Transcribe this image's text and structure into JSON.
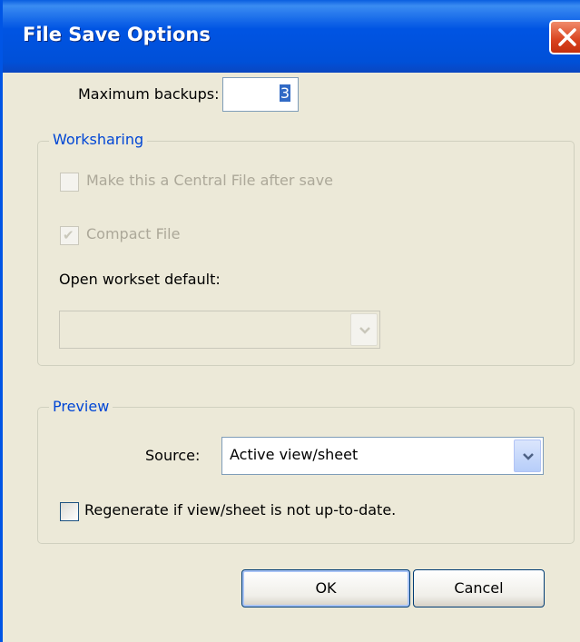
{
  "window": {
    "title": "File Save Options",
    "close_icon": "close-icon"
  },
  "backups": {
    "label": "Maximum backups:",
    "value": "3"
  },
  "worksharing": {
    "title": "Worksharing",
    "central_file_label": "Make this a Central File after save",
    "central_file_checked": false,
    "compact_file_label": "Compact File",
    "compact_file_checked": true,
    "workset_label": "Open workset default:",
    "workset_value": ""
  },
  "preview": {
    "title": "Preview",
    "source_label": "Source:",
    "source_value": "Active view/sheet",
    "regenerate_label": "Regenerate if view/sheet is not up-to-date.",
    "regenerate_checked": false
  },
  "buttons": {
    "ok": "OK",
    "cancel": "Cancel"
  },
  "colors": {
    "titlebar": "#0054e3",
    "dialog_bg": "#ece9d8",
    "group_title": "#0046d5",
    "disabled_text": "#aca899"
  }
}
